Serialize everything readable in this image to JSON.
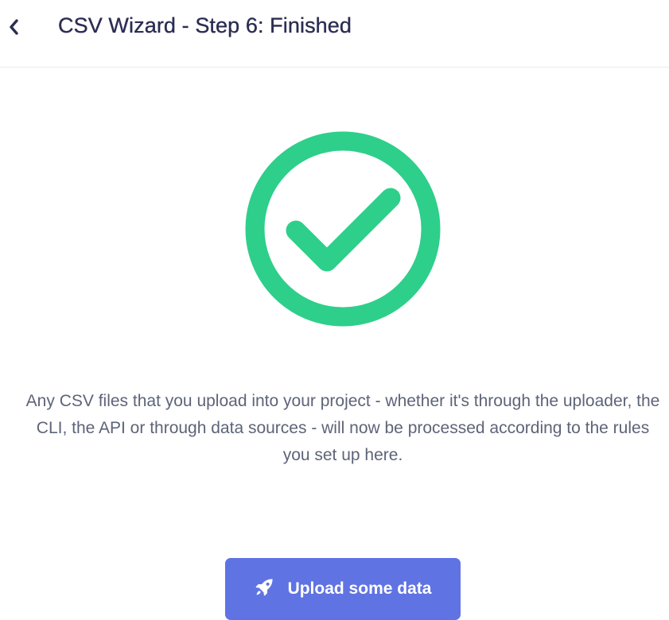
{
  "header": {
    "back_icon": "chevron-left-icon",
    "title": "CSV Wizard - Step 6: Finished"
  },
  "status": {
    "icon": "check-circle-icon",
    "color": "#2ecf8a"
  },
  "message": "Any CSV files that you upload into your project - whether it's through the uploader, the CLI, the API or through data sources - will now be processed according to the rules you set up here.",
  "action": {
    "icon": "rocket-icon",
    "label": "Upload some data",
    "color": "#6073e3"
  }
}
